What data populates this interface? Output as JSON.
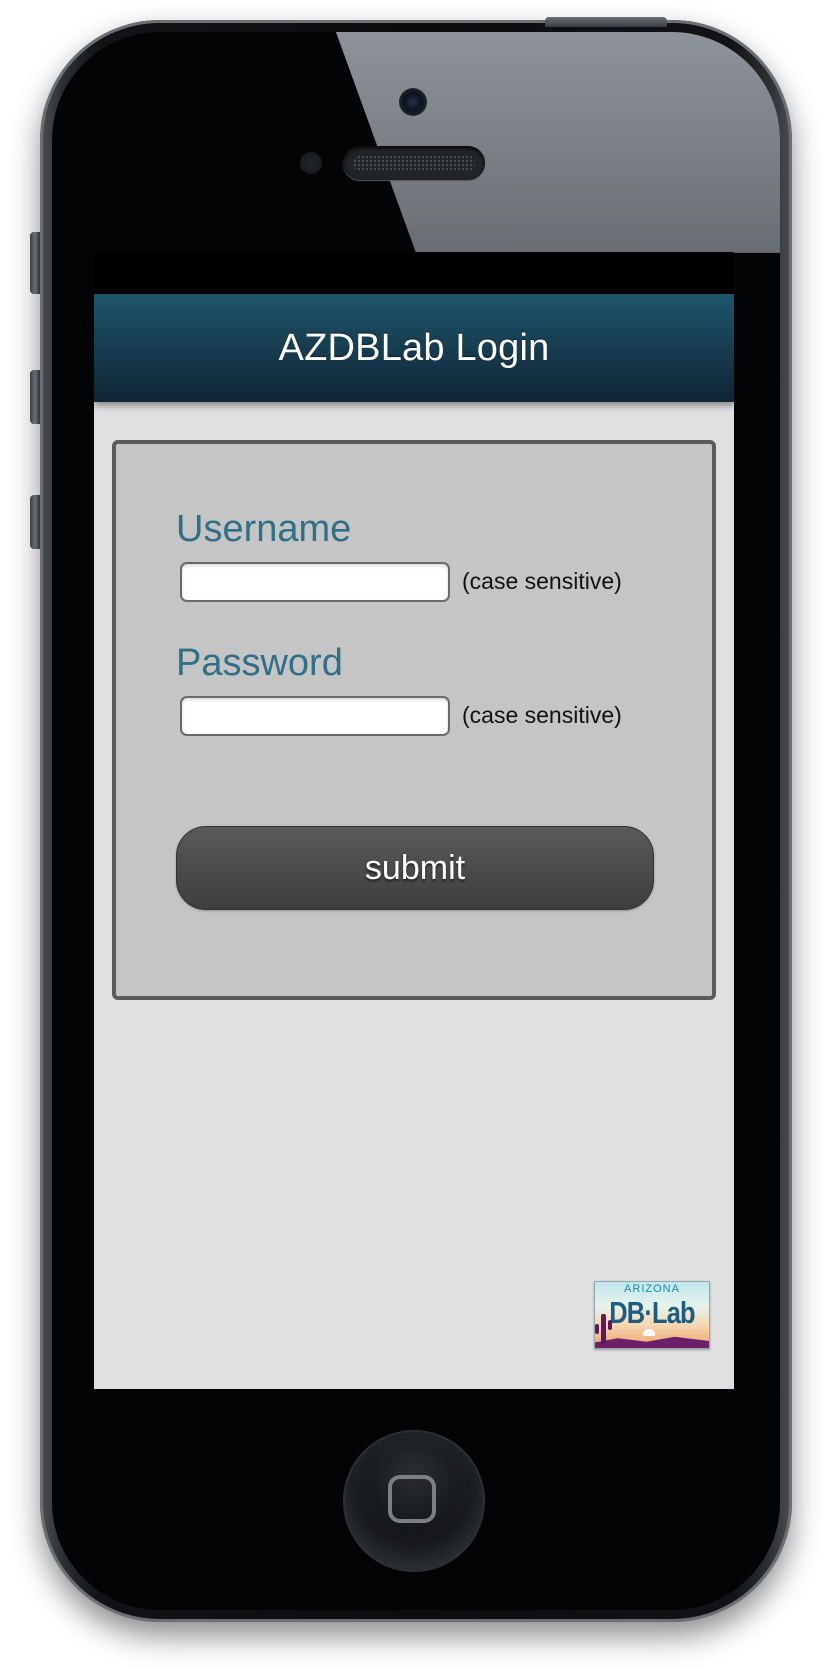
{
  "header": {
    "title": "AZDBLab Login"
  },
  "form": {
    "username_label": "Username",
    "username_value": "",
    "username_hint": "(case sensitive)",
    "password_label": "Password",
    "password_value": "",
    "password_hint": "(case sensitive)",
    "submit_label": "submit"
  },
  "logo": {
    "top_text": "ARIZONA",
    "main_text": "DB·Lab"
  },
  "colors": {
    "header": "#1d5569",
    "label": "#2f7088",
    "panel": "#c5c5c5",
    "button": "#4a4a4a",
    "screen_bg": "#e0e0e0"
  },
  "icons": {
    "home": "home-button-icon",
    "camera": "camera-icon",
    "speaker": "speaker-icon"
  }
}
